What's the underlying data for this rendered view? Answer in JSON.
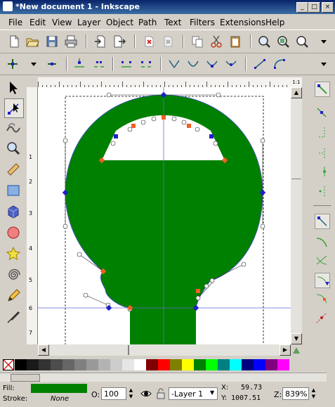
{
  "window": {
    "title": "*New document 1 - Inkscape",
    "buttons": {
      "minimize": "_",
      "maximize": "□",
      "close": "×"
    }
  },
  "menu": {
    "items": [
      "File",
      "Edit",
      "View",
      "Layer",
      "Object",
      "Path",
      "Text",
      "Filters",
      "Extensions",
      "Help"
    ]
  },
  "commands_toolbar": {
    "icons": [
      "new-document-icon",
      "open-icon",
      "save-icon",
      "print-icon",
      "import-icon",
      "export-icon",
      "undo-icon",
      "redo-icon",
      "copy-icon",
      "cut-icon",
      "paste-icon",
      "zoom-selection-icon",
      "zoom-drawing-icon",
      "zoom-page-icon",
      "more-icon"
    ]
  },
  "node_toolbar": {
    "icons": [
      "insert-node-icon",
      "delete-node-icon",
      "join-nodes-icon",
      "break-path-icon",
      "join-segment-icon",
      "delete-segment-icon",
      "make-cusp-icon",
      "make-smooth-icon",
      "make-symmetric-icon",
      "make-auto-smooth-icon",
      "segment-line-icon",
      "segment-curve-icon",
      "show-handles-icon"
    ]
  },
  "toolbox": {
    "tools": [
      "selector-tool-icon",
      "node-tool-icon",
      "tweak-tool-icon",
      "zoom-tool-icon",
      "measure-tool-icon",
      "rectangle-tool-icon",
      "3d-box-tool-icon",
      "ellipse-tool-icon",
      "star-tool-icon",
      "spiral-tool-icon",
      "pencil-tool-icon",
      "calligraphy-tool-icon"
    ],
    "active": "node-tool-icon"
  },
  "ruler": {
    "corner_label": "1:1",
    "v_ticks": [
      "1",
      "2",
      "3",
      "4",
      "5",
      "6",
      "7"
    ]
  },
  "colors": {
    "fill": "#008000",
    "path_outline": "#4b4bd6",
    "node_blue": "#2020c8",
    "node_orange": "#f06020",
    "guide": "#6a6ad6"
  },
  "palette": {
    "swatches": [
      "#000000",
      "#1a1a1a",
      "#333333",
      "#4d4d4d",
      "#666666",
      "#808080",
      "#999999",
      "#b3b3b3",
      "#cccccc",
      "#e6e6e6",
      "#ffffff",
      "#800000",
      "#ff0000",
      "#808000",
      "#ffff00",
      "#008000",
      "#00ff00",
      "#008080",
      "#00ffff",
      "#000080",
      "#0000ff",
      "#800080",
      "#ff00ff"
    ]
  },
  "status": {
    "fill_label": "Fill:",
    "stroke_label": "Stroke:",
    "stroke_value": "None",
    "opacity_label": "O:",
    "opacity_value": "100",
    "layer": "-Layer 1",
    "x_label": "X:",
    "x_value": "59.73",
    "y_label": "Y:",
    "y_value": "1007.51",
    "zoom_label": "Z:",
    "zoom_value": "839%"
  }
}
